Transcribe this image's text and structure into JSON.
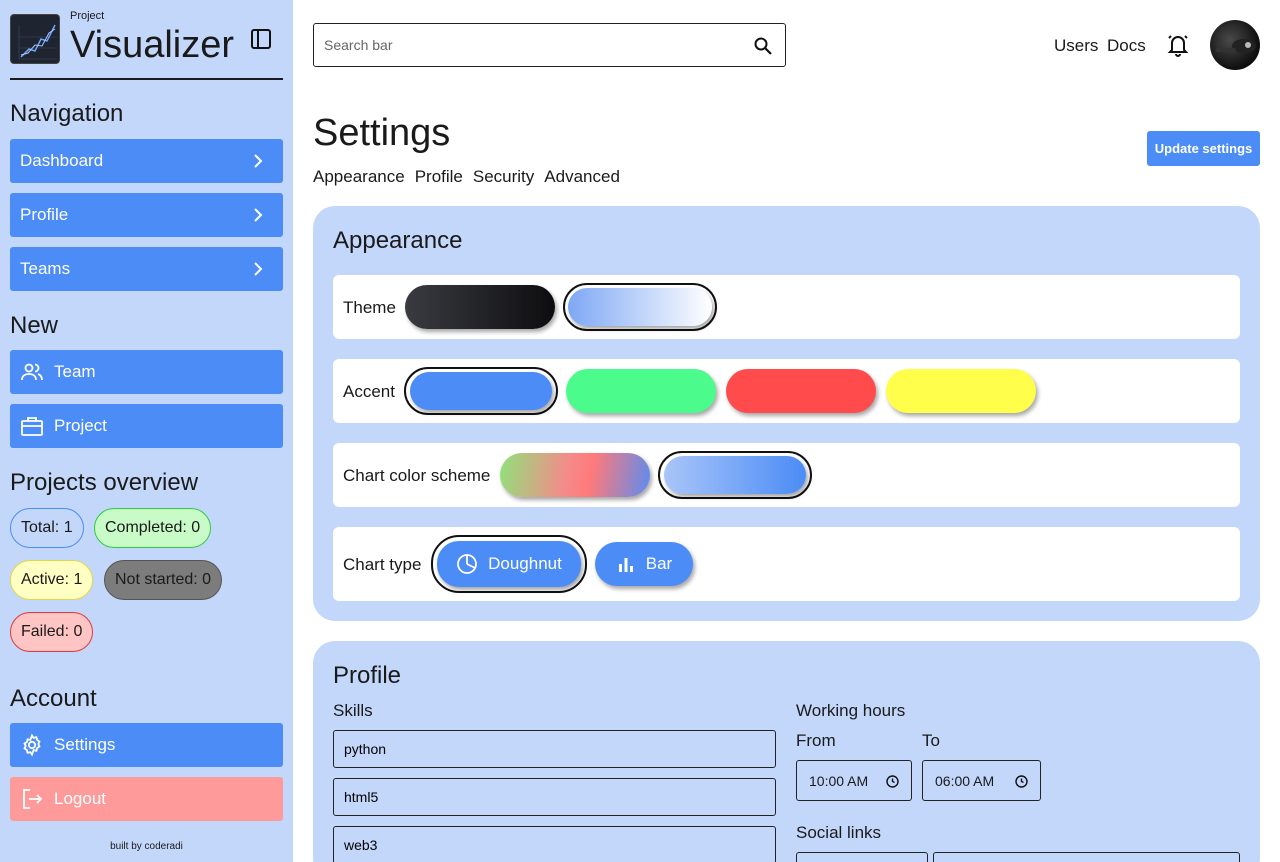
{
  "brand": {
    "small": "Project",
    "big": "Visualizer"
  },
  "sidebar": {
    "navigation_title": "Navigation",
    "nav_items": [
      {
        "label": "Dashboard"
      },
      {
        "label": "Profile"
      },
      {
        "label": "Teams"
      }
    ],
    "new_title": "New",
    "new_items": [
      {
        "label": "Team",
        "icon": "users-icon"
      },
      {
        "label": "Project",
        "icon": "briefcase-icon"
      }
    ],
    "overview_title": "Projects overview",
    "overview": {
      "total": "Total: 1",
      "completed": "Completed: 0",
      "active": "Active: 1",
      "not_started": "Not started: 0",
      "failed": "Failed: 0"
    },
    "account_title": "Account",
    "settings_label": "Settings",
    "logout_label": "Logout",
    "built_by": "built by coderadi"
  },
  "header": {
    "search_placeholder": "Search bar",
    "links": [
      "Users",
      "Docs"
    ]
  },
  "page": {
    "title": "Settings",
    "update_button": "Update settings",
    "tabs": [
      "Appearance",
      "Profile",
      "Security",
      "Advanced"
    ]
  },
  "appearance": {
    "title": "Appearance",
    "theme_label": "Theme",
    "accent_label": "Accent",
    "chart_scheme_label": "Chart color scheme",
    "chart_type_label": "Chart type",
    "chart_types": [
      "Doughnut",
      "Bar"
    ],
    "selected": {
      "theme": "light",
      "accent": "blue",
      "chart_scheme": "blue",
      "chart_type": "Doughnut"
    }
  },
  "profile": {
    "title": "Profile",
    "skills_label": "Skills",
    "skills": [
      "python",
      "html5",
      "web3"
    ],
    "working_hours_label": "Working hours",
    "from_label": "From",
    "to_label": "To",
    "from_value": "10:00 AM",
    "to_value": "06:00 AM",
    "social_links_label": "Social links"
  },
  "colors": {
    "sidebar_bg": "#c3d7fb",
    "accent_blue": "#4b8cf6",
    "logout_red": "#ff9a9a",
    "accent_green": "#4bfb8c",
    "accent_red": "#ff4b4b",
    "accent_yellow": "#ffff4b"
  }
}
